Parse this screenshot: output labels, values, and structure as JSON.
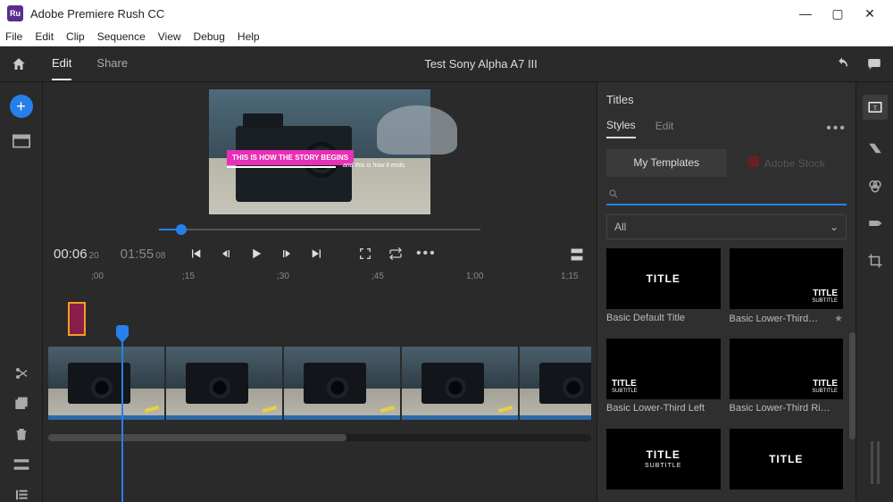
{
  "titlebar": {
    "app_icon_text": "Ru",
    "title": "Adobe Premiere Rush CC"
  },
  "menubar": [
    "File",
    "Edit",
    "Clip",
    "Sequence",
    "View",
    "Debug",
    "Help"
  ],
  "appbar": {
    "tabs": [
      "Edit",
      "Share"
    ],
    "active_tab": "Edit",
    "project_title": "Test Sony Alpha A7 III"
  },
  "preview": {
    "title_band": "THIS IS HOW THE STORY BEGINS",
    "subtitle": "and this is how it ends."
  },
  "playback": {
    "current_big": "00:06",
    "current_sm": "20",
    "duration_big": "01:55",
    "duration_sm": "08"
  },
  "ruler": [
    ";00",
    ";15",
    ";30",
    ";45",
    "1;00",
    "1;15"
  ],
  "ruler_pos": [
    48,
    150,
    256,
    362,
    468,
    574
  ],
  "titles_panel": {
    "heading": "Titles",
    "subtabs": [
      "Styles",
      "Edit"
    ],
    "src_tabs": [
      "My Templates",
      "Adobe Stock"
    ],
    "filter": "All",
    "search_placeholder": "",
    "cards": [
      {
        "label": "Basic Default Title",
        "variant": "center",
        "t1": "TITLE",
        "t2": ""
      },
      {
        "label": "Basic Lower-Third…",
        "variant": "lr",
        "t1": "TITLE",
        "t2": "SUBTITLE",
        "star": true
      },
      {
        "label": "Basic Lower-Third Left",
        "variant": "ll",
        "t1": "TITLE",
        "t2": "SUBTITLE"
      },
      {
        "label": "Basic Lower-Third Ri…",
        "variant": "lr",
        "t1": "TITLE",
        "t2": "SUBTITLE"
      },
      {
        "label": "",
        "variant": "center",
        "t1": "TITLE",
        "t2": "SUBTITLE"
      },
      {
        "label": "",
        "variant": "center",
        "t1": "TITLE",
        "t2": ""
      }
    ]
  }
}
